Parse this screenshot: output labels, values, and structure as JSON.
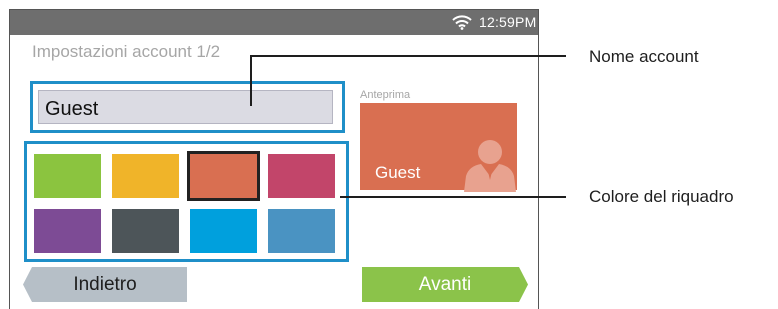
{
  "status_bar": {
    "time": "12:59PM",
    "wifi_icon": "wifi-icon"
  },
  "screen": {
    "title": "Impostazioni account 1/2",
    "account_name_value": "Guest",
    "preview_label": "Anteprima",
    "preview_name": "Guest",
    "preview_tile_color": "#d96f51",
    "selected_color": "#d96f51",
    "color_options": [
      "#8bc43f",
      "#f0b429",
      "#d96f51",
      "#c2456a",
      "#7d4b95",
      "#4d5559",
      "#00a0dd",
      "#4a93c2"
    ],
    "back_button_label": "Indietro",
    "next_button_label": "Avanti",
    "accent_color": "#1f8fc8"
  },
  "callouts": {
    "account_name": "Nome account",
    "tile_color": "Colore del riquadro"
  }
}
